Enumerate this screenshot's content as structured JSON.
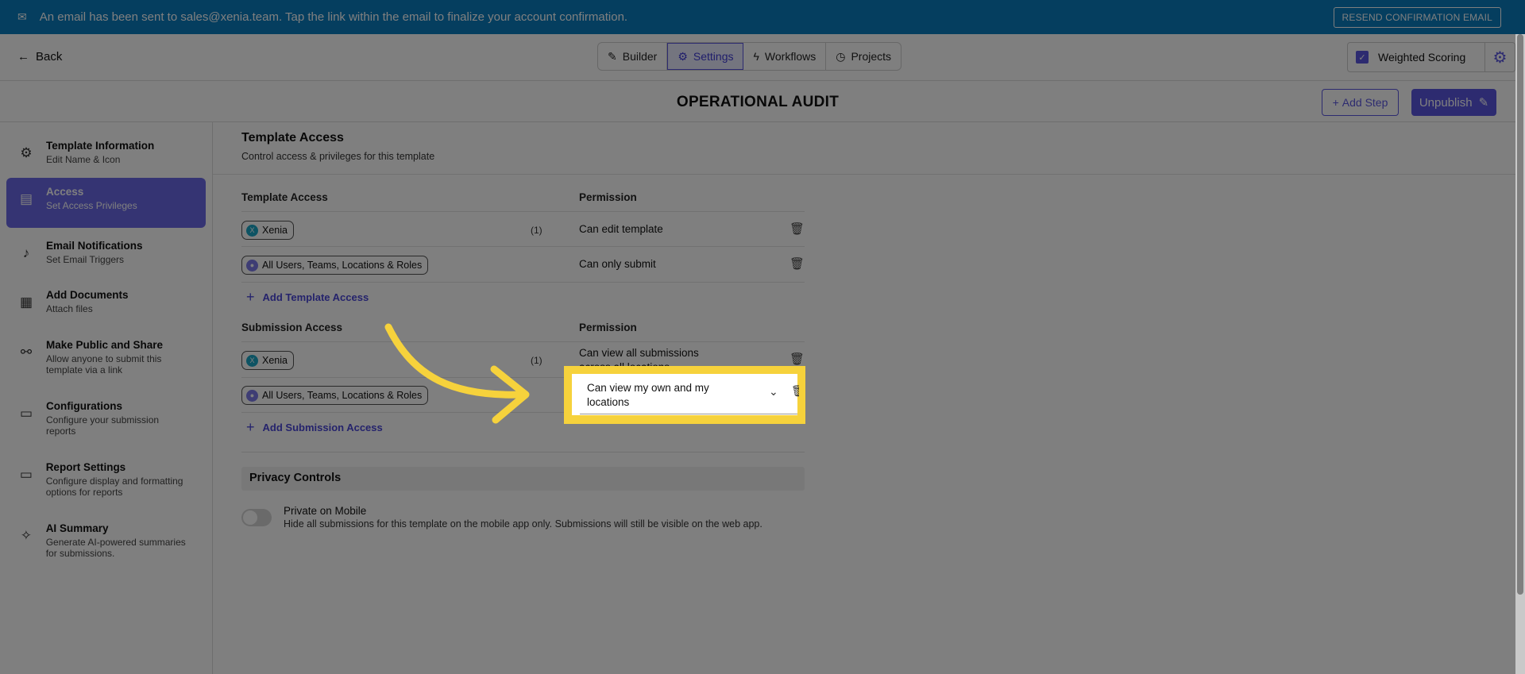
{
  "banner": {
    "message": "An email has been sent to sales@xenia.team. Tap the link within the email to finalize your account confirmation.",
    "resend_label": "RESEND CONFIRMATION EMAIL",
    "color": "#0a7cbf"
  },
  "nav": {
    "back_label": "Back",
    "tabs": [
      {
        "label": "Builder",
        "icon": "pencil-icon"
      },
      {
        "label": "Settings",
        "icon": "gear-icon",
        "active": true
      },
      {
        "label": "Workflows",
        "icon": "lightning-icon"
      },
      {
        "label": "Projects",
        "icon": "clock-icon"
      }
    ],
    "weighted_scoring_label": "Weighted Scoring",
    "weighted_scoring_checked": true
  },
  "header": {
    "title": "OPERATIONAL AUDIT",
    "add_step_label": "Add Step",
    "unpublish_label": "Unpublish",
    "accent": "#5b57e0"
  },
  "sidebar": {
    "items": [
      {
        "title": "Template Information",
        "subtitle": "Edit Name & Icon",
        "icon": "gear-icon"
      },
      {
        "title": "Access",
        "subtitle": "Set Access Privileges",
        "icon": "document-lock-icon",
        "active": true
      },
      {
        "title": "Email Notifications",
        "subtitle": "Set Email Triggers",
        "icon": "bell-icon"
      },
      {
        "title": "Add Documents",
        "subtitle": "Attach files",
        "icon": "documents-icon"
      },
      {
        "title": "Make Public and Share",
        "subtitle": "Allow anyone to submit this template via a link",
        "icon": "link-icon"
      },
      {
        "title": "Configurations",
        "subtitle": "Configure your submission reports",
        "icon": "presentation-icon"
      },
      {
        "title": "Report Settings",
        "subtitle": "Configure display and formatting options for reports",
        "icon": "presentation-icon"
      },
      {
        "title": "AI Summary",
        "subtitle": "Generate AI-powered summaries for submissions.",
        "icon": "sparkle-pen-icon"
      }
    ]
  },
  "main": {
    "title": "Template Access",
    "subtitle": "Control access & privileges for this template",
    "template_access": {
      "col_access": "Template Access",
      "col_permission": "Permission",
      "rows": [
        {
          "name": "Xenia",
          "count": "(1)",
          "permission": "Can edit template"
        },
        {
          "name": "All Users, Teams, Locations & Roles",
          "count": "",
          "permission": "Can only submit"
        }
      ],
      "add_label": "Add Template Access"
    },
    "submission_access": {
      "col_access": "Submission Access",
      "col_permission": "Permission",
      "rows": [
        {
          "name": "Xenia",
          "count": "(1)",
          "permission": "Can view all submissions across all locations"
        },
        {
          "name": "All Users, Teams, Locations & Roles",
          "count": "",
          "permission": "Can view my own and my locations"
        }
      ],
      "add_label": "Add Submission Access"
    },
    "privacy": {
      "title": "Privacy Controls",
      "toggle_label": "Private on Mobile",
      "toggle_description": "Hide all submissions for this template on the mobile app only. Submissions will still be visible on the web app.",
      "toggle_on": false
    }
  },
  "highlight_color": "#f6d23c"
}
